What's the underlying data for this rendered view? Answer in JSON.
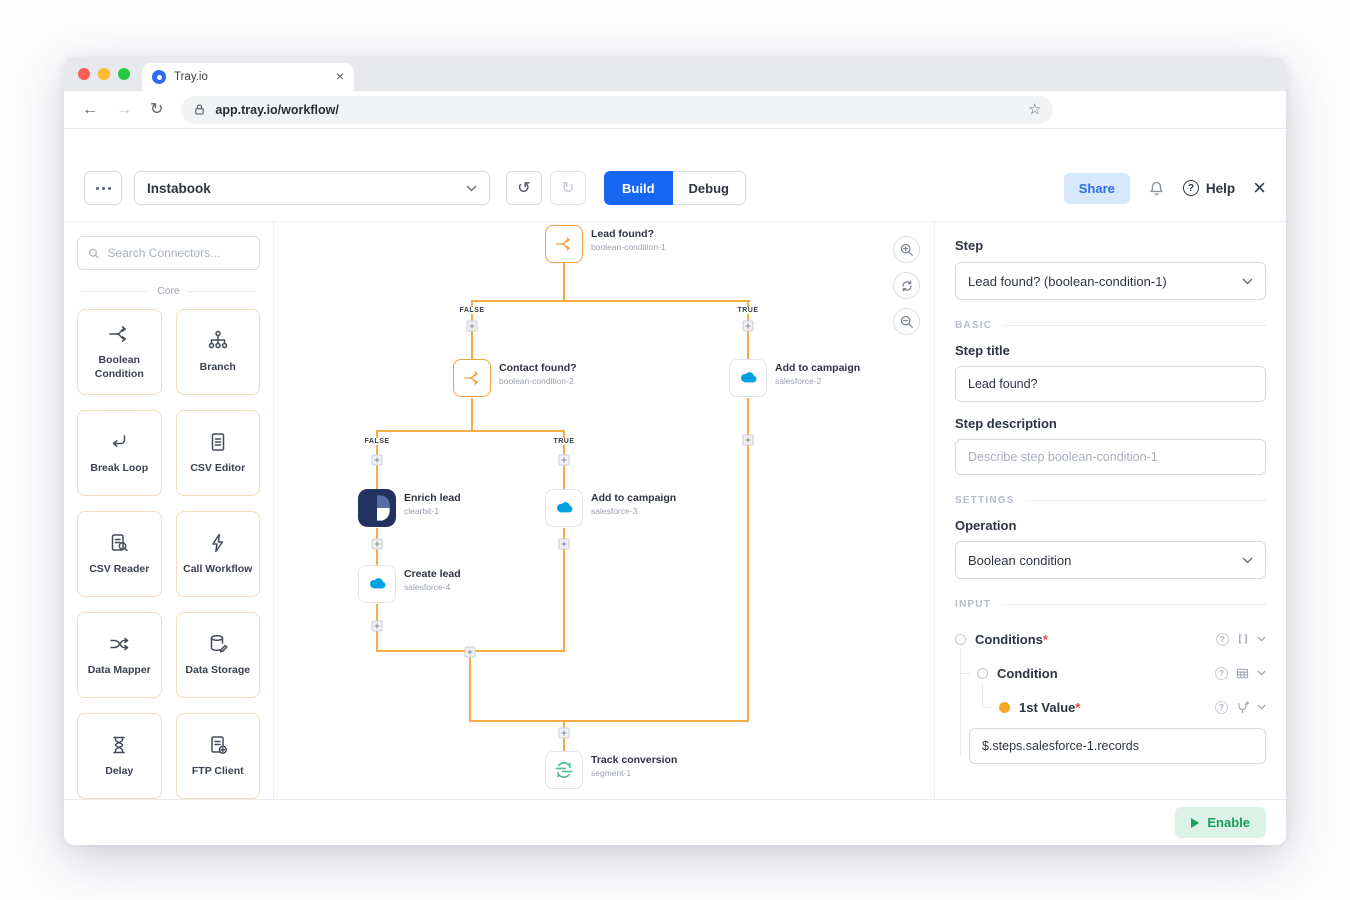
{
  "browser": {
    "tab_title": "Tray.io",
    "url": "app.tray.io/workflow/"
  },
  "toolbar": {
    "workflow_name": "Instabook",
    "build_label": "Build",
    "debug_label": "Debug",
    "share_label": "Share",
    "help_label": "Help"
  },
  "sidebar": {
    "search_placeholder": "Search Connectors...",
    "section_label": "Core",
    "connectors": [
      {
        "label": "Boolean Condition",
        "icon": "boolean-condition-icon"
      },
      {
        "label": "Branch",
        "icon": "branch-icon"
      },
      {
        "label": "Break Loop",
        "icon": "break-loop-icon"
      },
      {
        "label": "CSV Editor",
        "icon": "csv-editor-icon"
      },
      {
        "label": "CSV Reader",
        "icon": "csv-reader-icon"
      },
      {
        "label": "Call Workflow",
        "icon": "call-workflow-icon"
      },
      {
        "label": "Data Mapper",
        "icon": "data-mapper-icon"
      },
      {
        "label": "Data Storage",
        "icon": "data-storage-icon"
      },
      {
        "label": "Delay",
        "icon": "delay-icon"
      },
      {
        "label": "FTP Client",
        "icon": "ftp-client-icon"
      }
    ]
  },
  "canvas": {
    "branch_false": "FALSE",
    "branch_true": "TRUE",
    "nodes": {
      "lead_found": {
        "title": "Lead found?",
        "subtitle": "boolean-condition-1",
        "icon": "boolean-condition-icon"
      },
      "contact_found": {
        "title": "Contact found?",
        "subtitle": "boolean-condition-2",
        "icon": "boolean-condition-icon"
      },
      "add_to_campaign_2": {
        "title": "Add to campaign",
        "subtitle": "salesforce-2",
        "icon": "salesforce-icon"
      },
      "enrich_lead": {
        "title": "Enrich lead",
        "subtitle": "clearbit-1",
        "icon": "clearbit-icon"
      },
      "add_to_campaign_3": {
        "title": "Add to campaign",
        "subtitle": "salesforce-3",
        "icon": "salesforce-icon"
      },
      "create_lead": {
        "title": "Create lead",
        "subtitle": "salesforce-4",
        "icon": "salesforce-icon"
      },
      "track_conversion": {
        "title": "Track conversion",
        "subtitle": "segment-1",
        "icon": "segment-icon"
      }
    }
  },
  "panel": {
    "step_label": "Step",
    "step_selector_value": "Lead found? (boolean-condition-1)",
    "basic_section": "BASIC",
    "step_title_label": "Step title",
    "step_title_value": "Lead found?",
    "step_description_label": "Step description",
    "step_description_placeholder": "Describe step boolean-condition-1",
    "settings_section": "SETTINGS",
    "operation_label": "Operation",
    "operation_value": "Boolean condition",
    "input_section": "INPUT",
    "conditions_label": "Conditions",
    "condition_label": "Condition",
    "first_value_label": "1st Value",
    "required_mark": "*",
    "array_type_label": "[]",
    "first_value_input": "$.steps.salesforce-1.records"
  },
  "footer": {
    "enable_label": "Enable"
  },
  "colors": {
    "accent_orange": "#F7AB45",
    "build_blue": "#1767F2",
    "salesforce_blue": "#00A1E0",
    "segment_green": "#52BD95",
    "clearbit_navy": "#22335F",
    "enable_green": "#17A05A",
    "share_blue": "#2B6DE4"
  }
}
